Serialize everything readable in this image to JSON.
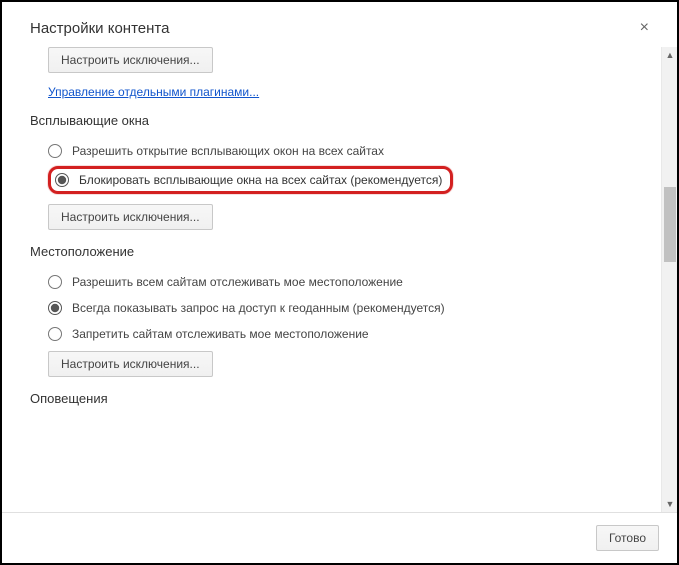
{
  "dialog": {
    "title": "Настройки контента",
    "done_label": "Готово"
  },
  "sections": {
    "plugins": {
      "exceptions_btn": "Настроить исключения...",
      "manage_link": "Управление отдельными плагинами..."
    },
    "popups": {
      "title": "Всплывающие окна",
      "allow_label": "Разрешить открытие всплывающих окон на всех сайтах",
      "block_label": "Блокировать всплывающие окна на всех сайтах (рекомендуется)",
      "exceptions_btn": "Настроить исключения..."
    },
    "location": {
      "title": "Местоположение",
      "allow_label": "Разрешить всем сайтам отслеживать мое местоположение",
      "ask_label": "Всегда показывать запрос на доступ к геоданным (рекомендуется)",
      "block_label": "Запретить сайтам отслеживать мое местоположение",
      "exceptions_btn": "Настроить исключения..."
    },
    "notifications": {
      "title": "Оповещения"
    }
  }
}
